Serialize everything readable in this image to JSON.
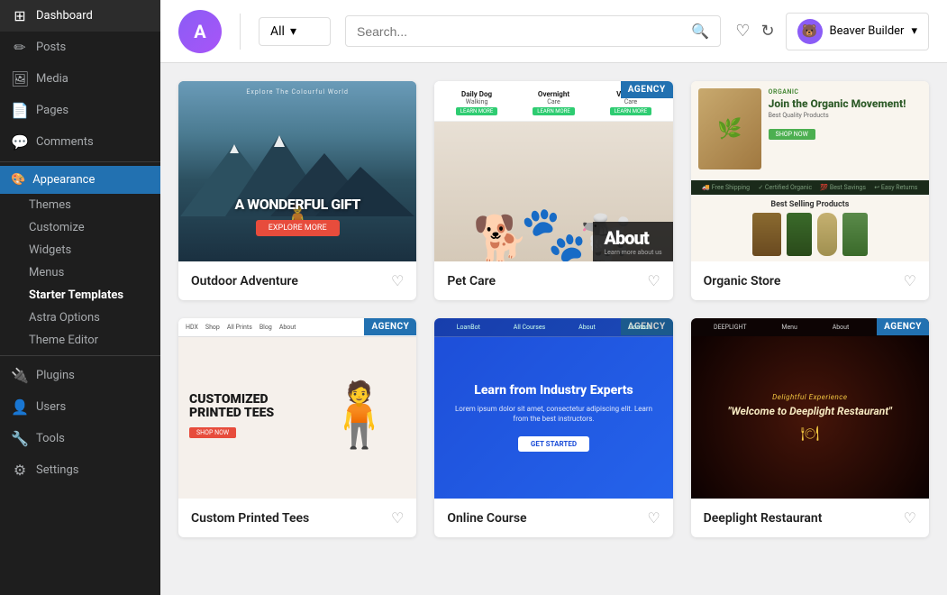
{
  "sidebar": {
    "items": [
      {
        "id": "dashboard",
        "label": "Dashboard",
        "icon": "⊞"
      },
      {
        "id": "posts",
        "label": "Posts",
        "icon": "📝"
      },
      {
        "id": "media",
        "label": "Media",
        "icon": "🖼"
      },
      {
        "id": "pages",
        "label": "Pages",
        "icon": "📄"
      },
      {
        "id": "comments",
        "label": "Comments",
        "icon": "💬"
      },
      {
        "id": "appearance",
        "label": "Appearance",
        "icon": "🎨",
        "active": true
      },
      {
        "id": "plugins",
        "label": "Plugins",
        "icon": "🔌"
      },
      {
        "id": "users",
        "label": "Users",
        "icon": "👤"
      },
      {
        "id": "tools",
        "label": "Tools",
        "icon": "🔧"
      },
      {
        "id": "settings",
        "label": "Settings",
        "icon": "⚙"
      }
    ],
    "appearance_sub": [
      {
        "id": "themes",
        "label": "Themes"
      },
      {
        "id": "customize",
        "label": "Customize"
      },
      {
        "id": "widgets",
        "label": "Widgets"
      },
      {
        "id": "menus",
        "label": "Menus"
      },
      {
        "id": "starter-templates",
        "label": "Starter Templates",
        "highlighted": true
      },
      {
        "id": "astra-options",
        "label": "Astra Options"
      },
      {
        "id": "theme-editor",
        "label": "Theme Editor"
      }
    ]
  },
  "header": {
    "logo_letter": "A",
    "filter_label": "All",
    "filter_chevron": "▾",
    "search_placeholder": "Search...",
    "search_icon": "🔍",
    "heart_icon": "♡",
    "refresh_icon": "↻",
    "beaver_builder_label": "Beaver Builder",
    "beaver_avatar_text": "🦫"
  },
  "templates": [
    {
      "id": "outdoor-adventure",
      "title": "Outdoor Adventure",
      "badge": null,
      "preview_type": "outdoor"
    },
    {
      "id": "pet-care",
      "title": "Pet Care",
      "badge": "AGENCY",
      "preview_type": "pet"
    },
    {
      "id": "organic-store",
      "title": "Organic Store",
      "badge": null,
      "preview_type": "organic"
    },
    {
      "id": "tshirt",
      "title": "Custom Printed Tees",
      "badge": "AGENCY",
      "preview_type": "tshirt"
    },
    {
      "id": "course",
      "title": "Online Course",
      "badge": "AGENCY",
      "preview_type": "course"
    },
    {
      "id": "restaurant",
      "title": "Deeplight Restaurant",
      "badge": "AGENCY",
      "preview_type": "restaurant"
    }
  ],
  "badges": {
    "agency_label": "AGENCY"
  },
  "icons": {
    "heart": "♡",
    "chevron_down": "▾",
    "search": "🔍",
    "refresh": "↻",
    "arrow_right": "←"
  }
}
